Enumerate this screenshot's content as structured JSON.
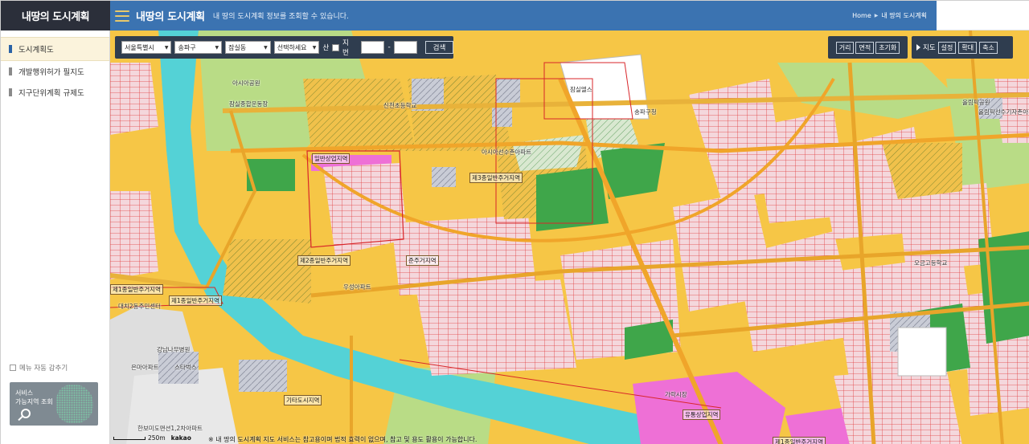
{
  "app": {
    "logo": "내땅의 도시계획"
  },
  "header": {
    "title": "내땅의 도시계획",
    "subtitle": "내 땅의 도시계획 정보를 조회할 수 있습니다.",
    "breadcrumb": [
      "Home",
      "내 땅의 도시계획"
    ]
  },
  "sidebar": {
    "items": [
      {
        "label": "도시계획도",
        "active": true
      },
      {
        "label": "개발행위허가 필지도",
        "active": false
      },
      {
        "label": "지구단위계획 규제도",
        "active": false
      }
    ],
    "auto_hide": "메뉴 자동 감추기",
    "service_box": {
      "line1": "서비스",
      "line2": "가능지역 조회"
    }
  },
  "search": {
    "sido": "서울특별시",
    "sigungu": "송파구",
    "dong": "잠실동",
    "select": "선택하세요",
    "san_label": "산",
    "jibun_label": "지번",
    "dash": "-",
    "search_button": "검색"
  },
  "tools": {
    "measure": [
      "거리",
      "면적",
      "초기화"
    ],
    "map_label": "지도",
    "map_buttons": [
      "설정",
      "확대",
      "축소"
    ]
  },
  "map": {
    "labels": [
      "제1종일반주거지역",
      "제2종일반주거지역",
      "제3종일반주거지역",
      "준주거지역",
      "일반상업지역",
      "유통상업지역",
      "기타도시지역",
      "제1종일반주거지역",
      "제1종일반주거지역"
    ],
    "places": [
      "아시아공원",
      "잠실종합운동장",
      "우성아파트",
      "신천초등학교",
      "잠실엘스",
      "아시아선수촌아파트",
      "송파구청",
      "오금고등학교",
      "강남나무병원",
      "은마아파트",
      "스타벅스",
      "대치2동주민센터",
      "한보미도맨션1,2차아파트",
      "가락시장",
      "유통상업지역",
      "올림픽공원",
      "올림픽선수기자촌아파트"
    ],
    "scale": "250m",
    "provider": "kakao",
    "notice": "※ 내 땅의 도시계획 지도 서비스는 참고용이며 법적 효력이 없으며, 참고 및 용도 활용이 가능합니다."
  },
  "colors": {
    "header": "#3b73b1",
    "logo_bg": "#2b2f3a",
    "toolbar": "#2f3d4f",
    "residential_yellow": "#f6c646",
    "parcel_pink": "#f4d7dc",
    "green": "#3fa64a",
    "water": "#54d2d6",
    "commercial_magenta": "#ee70d6"
  }
}
